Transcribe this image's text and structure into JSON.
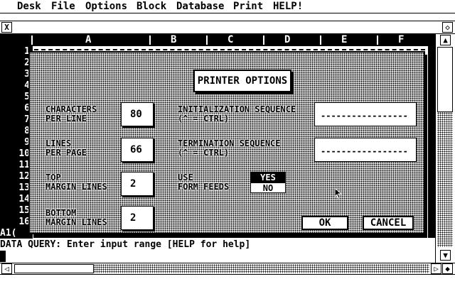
{
  "menu": {
    "items": [
      "Desk",
      "File",
      "Options",
      "Block",
      "Database",
      "Print",
      "HELP!"
    ]
  },
  "window": {
    "close_icon": "X",
    "fullscreen_icon": "◇",
    "columns": [
      "A",
      "B",
      "C",
      "D",
      "E",
      "F"
    ],
    "rows": [
      "1",
      "2",
      "3",
      "4",
      "5",
      "6",
      "7",
      "8",
      "9",
      "10",
      "11",
      "12",
      "13",
      "14",
      "15",
      "16"
    ],
    "cell_ref": "A1(",
    "query_line": "DATA QUERY: Enter input range [HELP for help]",
    "scroll_up_icon": "▲",
    "scroll_down_icon": "▼",
    "scroll_left_icon": "◁",
    "scroll_right_icon": "▷",
    "size_icon": "◆"
  },
  "dialog": {
    "title": "PRINTER OPTIONS",
    "chars_label": "CHARACTERS\nPER LINE",
    "chars_value": "80",
    "lines_label": "LINES\nPER PAGE",
    "lines_value": "66",
    "top_label": "TOP\nMARGIN LINES",
    "top_value": "2",
    "bottom_label": "BOTTOM\nMARGIN LINES",
    "bottom_value": "2",
    "init_label": "INITIALIZATION SEQUENCE\n(^ = CTRL)",
    "init_value": "-----------------",
    "term_label": "TERMINATION SEQUENCE\n(^ = CTRL)",
    "term_value": "-----------------",
    "formfeed_label": "USE\nFORM FEEDS",
    "yes_label": "YES",
    "no_label": "NO",
    "formfeed_selected": "YES",
    "ok_label": "OK",
    "cancel_label": "CANCEL"
  }
}
